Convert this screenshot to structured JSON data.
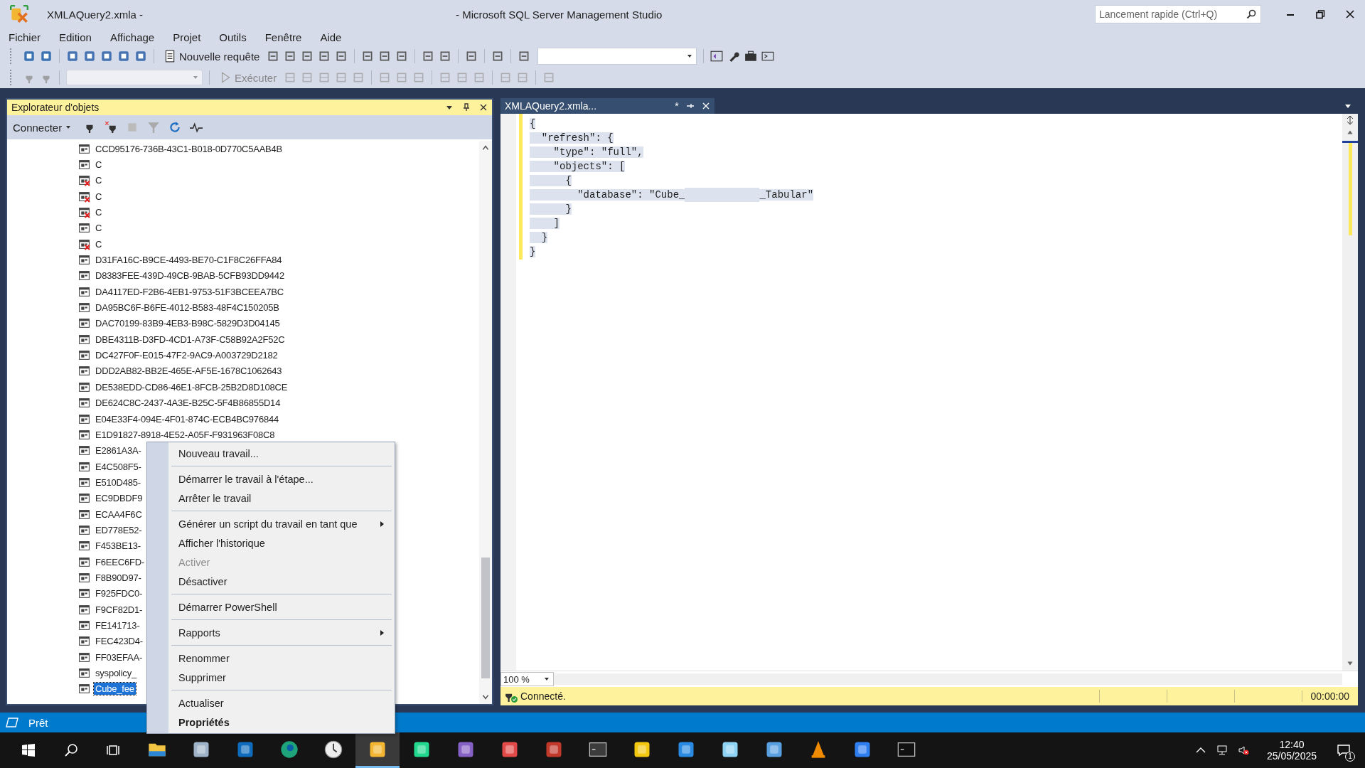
{
  "window": {
    "title_file": "XMLAQuery2.xmla -",
    "title_app": "- Microsoft SQL Server Management Studio",
    "quick_launch": {
      "placeholder": "Lancement rapide (Ctrl+Q)"
    }
  },
  "menu": [
    "Fichier",
    "Edition",
    "Affichage",
    "Projet",
    "Outils",
    "Fenêtre",
    "Aide"
  ],
  "toolbar": {
    "new_query": "Nouvelle requête",
    "execute": "Exécuter"
  },
  "object_explorer": {
    "title": "Explorateur d'objets",
    "connect": "Connecter",
    "items": [
      {
        "label": "CCD95176-736B-43C1-B018-0D770C5AAB4B",
        "failed": false,
        "selected": false
      },
      {
        "label": "C",
        "failed": false,
        "selected": false
      },
      {
        "label": "C",
        "failed": true,
        "selected": false
      },
      {
        "label": "C",
        "failed": true,
        "selected": false
      },
      {
        "label": "C",
        "failed": true,
        "selected": false
      },
      {
        "label": "C",
        "failed": false,
        "selected": false
      },
      {
        "label": "C",
        "failed": true,
        "selected": false
      },
      {
        "label": "D31FA16C-B9CE-4493-BE70-C1F8C26FFA84",
        "failed": false,
        "selected": false
      },
      {
        "label": "D8383FEE-439D-49CB-9BAB-5CFB93DD9442",
        "failed": false,
        "selected": false
      },
      {
        "label": "DA4117ED-F2B6-4EB1-9753-51F3BCEEA7BC",
        "failed": false,
        "selected": false
      },
      {
        "label": "DA95BC6F-B6FE-4012-B583-48F4C150205B",
        "failed": false,
        "selected": false
      },
      {
        "label": "DAC70199-83B9-4EB3-B98C-5829D3D04145",
        "failed": false,
        "selected": false
      },
      {
        "label": "DBE4311B-D3FD-4CD1-A73F-C58B92A2F52C",
        "failed": false,
        "selected": false
      },
      {
        "label": "DC427F0F-E015-47F2-9AC9-A003729D2182",
        "failed": false,
        "selected": false
      },
      {
        "label": "DDD2AB82-BB2E-465E-AF5E-1678C1062643",
        "failed": false,
        "selected": false
      },
      {
        "label": "DE538EDD-CD86-46E1-8FCB-25B2D8D108CE",
        "failed": false,
        "selected": false
      },
      {
        "label": "DE624C8C-2437-4A3E-B25C-5F4B86855D14",
        "failed": false,
        "selected": false
      },
      {
        "label": "E04E33F4-094E-4F01-874C-ECB4BC976844",
        "failed": false,
        "selected": false
      },
      {
        "label": "E1D91827-8918-4E52-A05F-F931963F08C8",
        "failed": false,
        "selected": false
      },
      {
        "label": "E2861A3A-",
        "failed": false,
        "selected": false
      },
      {
        "label": "E4C508F5-",
        "failed": false,
        "selected": false
      },
      {
        "label": "E510D485-",
        "failed": false,
        "selected": false
      },
      {
        "label": "EC9DBDF9",
        "failed": false,
        "selected": false
      },
      {
        "label": "ECAA4F6C",
        "failed": false,
        "selected": false
      },
      {
        "label": "ED778E52-",
        "failed": false,
        "selected": false
      },
      {
        "label": "F453BE13-",
        "failed": false,
        "selected": false
      },
      {
        "label": "F6EEC6FD-",
        "failed": false,
        "selected": false
      },
      {
        "label": "F8B90D97-",
        "failed": false,
        "selected": false
      },
      {
        "label": "F925FDC0-",
        "failed": false,
        "selected": false
      },
      {
        "label": "F9CF82D1-",
        "failed": false,
        "selected": false
      },
      {
        "label": "FE141713-",
        "failed": false,
        "selected": false
      },
      {
        "label": "FEC423D4-",
        "failed": false,
        "selected": false
      },
      {
        "label": "FF03EFAA-",
        "failed": false,
        "selected": false
      },
      {
        "label": "syspolicy_",
        "failed": false,
        "selected": false
      },
      {
        "label": "Cube_fee",
        "failed": false,
        "selected": true
      }
    ]
  },
  "context_menu": {
    "groups": [
      [
        {
          "label": "Nouveau travail...",
          "disabled": false,
          "submenu": false,
          "default": false
        }
      ],
      [
        {
          "label": "Démarrer le travail à l'étape...",
          "disabled": false,
          "submenu": false,
          "default": false
        },
        {
          "label": "Arrêter le travail",
          "disabled": false,
          "submenu": false,
          "default": false
        }
      ],
      [
        {
          "label": "Générer un script du travail en tant que",
          "disabled": false,
          "submenu": true,
          "default": false
        },
        {
          "label": "Afficher l'historique",
          "disabled": false,
          "submenu": false,
          "default": false
        },
        {
          "label": "Activer",
          "disabled": true,
          "submenu": false,
          "default": false
        },
        {
          "label": "Désactiver",
          "disabled": false,
          "submenu": false,
          "default": false
        }
      ],
      [
        {
          "label": "Démarrer PowerShell",
          "disabled": false,
          "submenu": false,
          "default": false
        }
      ],
      [
        {
          "label": "Rapports",
          "disabled": false,
          "submenu": true,
          "default": false
        }
      ],
      [
        {
          "label": "Renommer",
          "disabled": false,
          "submenu": false,
          "default": false
        },
        {
          "label": "Supprimer",
          "disabled": false,
          "submenu": false,
          "default": false
        }
      ],
      [
        {
          "label": "Actualiser",
          "disabled": false,
          "submenu": false,
          "default": false
        },
        {
          "label": "Propriétés",
          "disabled": false,
          "submenu": false,
          "default": true
        }
      ]
    ]
  },
  "editor": {
    "tab_title": "XMLAQuery2.xmla...",
    "tab_mark": "*",
    "lines": [
      [
        "{"
      ],
      [
        "  \"refresh\": {"
      ],
      [
        "    \"type\": \"full\","
      ],
      [
        "    \"objects\": ["
      ],
      [
        "      {"
      ],
      [
        "        \"database\": \"Cube_",
        "_Tabular\""
      ],
      [
        "      }"
      ],
      [
        "    ]"
      ],
      [
        "  }"
      ],
      [
        "}"
      ]
    ],
    "zoom": "100 %",
    "status": "Connecté.",
    "elapsed": "00:00:00"
  },
  "status_bar": "Prêt",
  "taskbar": {
    "apps": [
      {
        "kind": "folder",
        "selected": false
      },
      {
        "kind": "monitor",
        "selected": false
      },
      {
        "kind": "outlook",
        "selected": false
      },
      {
        "kind": "edge",
        "selected": false
      },
      {
        "kind": "clock",
        "selected": false
      },
      {
        "kind": "ssms",
        "selected": true
      },
      {
        "kind": "datagrip",
        "selected": false
      },
      {
        "kind": "vs",
        "selected": false
      },
      {
        "kind": "snip",
        "selected": false
      },
      {
        "kind": "toolbox",
        "selected": false
      },
      {
        "kind": "terminal",
        "selected": false
      },
      {
        "kind": "powerbi",
        "selected": false
      },
      {
        "kind": "vscode",
        "selected": false
      },
      {
        "kind": "notepad",
        "selected": false
      },
      {
        "kind": "server",
        "selected": false
      },
      {
        "kind": "vlc",
        "selected": false
      },
      {
        "kind": "automate",
        "selected": false
      },
      {
        "kind": "cmd",
        "selected": false
      }
    ],
    "time": "12:40",
    "date": "25/05/2025",
    "notifications": "1"
  }
}
